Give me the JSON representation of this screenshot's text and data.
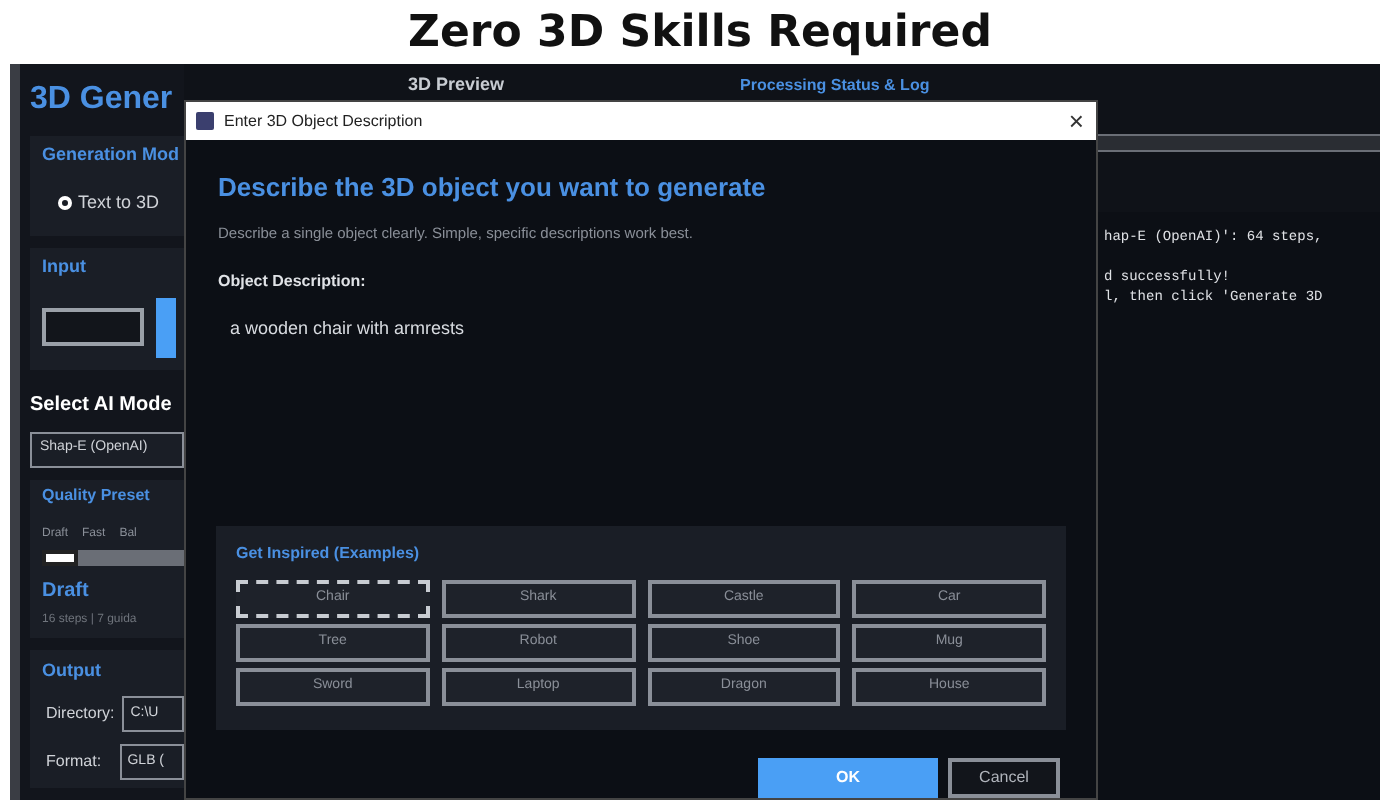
{
  "banner": {
    "title": "Zero 3D Skills Required"
  },
  "app": {
    "title": "3D Gener",
    "generation_mode": {
      "heading": "Generation Mod",
      "options": [
        {
          "label": "Text to 3D",
          "selected": true
        }
      ]
    },
    "input": {
      "heading": "Input"
    },
    "model": {
      "heading": "Select AI Mode",
      "value": "Shap-E (OpenAI)"
    },
    "quality": {
      "heading": "Quality Preset",
      "ticks": [
        "Draft",
        "Fast",
        "Bal"
      ],
      "level": 0,
      "preset": "Draft",
      "details": "16 steps | 7 guida"
    },
    "output": {
      "heading": "Output",
      "fields": [
        {
          "label": "Directory:",
          "value": "C:\\U"
        },
        {
          "label": "Format:",
          "value": "GLB ("
        }
      ]
    },
    "preview_heading": "3D Preview",
    "status_heading": "Processing Status & Log",
    "log": [
      [
        "hap-E (OpenAI)': 64 steps,"
      ],
      [
        "d successfully!",
        "l, then click 'Generate 3D"
      ]
    ]
  },
  "dialog": {
    "title": "Enter 3D Object Description",
    "close": "×",
    "heading": "Describe the 3D object you want to generate",
    "hint": "Describe a single object clearly. Simple, specific descriptions work best.",
    "field_label": "Object Description:",
    "description": "a wooden chair with armrests",
    "examples_heading": "Get Inspired (Examples)",
    "examples": [
      {
        "label": "Chair",
        "focused": true
      },
      {
        "label": "Shark",
        "focused": false
      },
      {
        "label": "Castle",
        "focused": false
      },
      {
        "label": "Car",
        "focused": false
      },
      {
        "label": "Tree",
        "focused": false
      },
      {
        "label": "Robot",
        "focused": false
      },
      {
        "label": "Shoe",
        "focused": false
      },
      {
        "label": "Mug",
        "focused": false
      },
      {
        "label": "Sword",
        "focused": false
      },
      {
        "label": "Laptop",
        "focused": false
      },
      {
        "label": "Dragon",
        "focused": false
      },
      {
        "label": "House",
        "focused": false
      }
    ],
    "buttons": [
      {
        "label": "OK",
        "kind": "primary"
      },
      {
        "label": "Cancel",
        "kind": "secondary"
      }
    ]
  }
}
